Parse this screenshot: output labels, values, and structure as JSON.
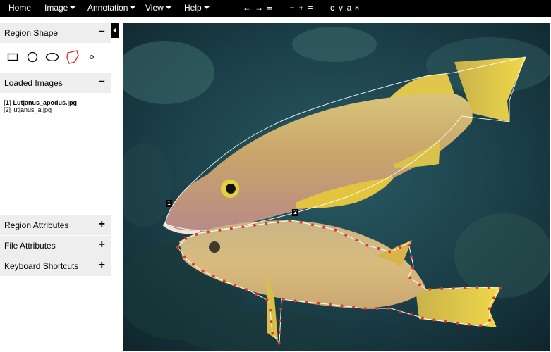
{
  "menu": {
    "home": "Home",
    "image": "Image",
    "annotation": "Annotation",
    "view": "View",
    "help": "Help"
  },
  "toolbar": {
    "prev": "←",
    "next": "→",
    "list": "≡",
    "zoom_out": "−",
    "zoom_in": "+",
    "zoom_reset": "=",
    "copy": "c",
    "paste": "v",
    "select_all": "a",
    "delete": "×"
  },
  "left_panel": {
    "region_shape": {
      "title": "Region Shape",
      "sign": "−",
      "active_shape": "polygon",
      "shape_icons": [
        "rectangle-icon",
        "circle-icon",
        "ellipse-icon",
        "polygon-icon",
        "point-icon"
      ],
      "active_color": "#e8332a"
    },
    "loaded_images": {
      "title": "Loaded Images",
      "sign": "−",
      "items": [
        {
          "label": "[1] Lutjanus_apodus.jpg",
          "active": true
        },
        {
          "label": "[2] lutjanus_a.jpg",
          "active": false
        }
      ]
    },
    "region_attributes": {
      "title": "Region Attributes",
      "sign": "+"
    },
    "file_attributes": {
      "title": "File Attributes",
      "sign": "+"
    },
    "keyboard_shortcuts": {
      "title": "Keyboard Shortcuts",
      "sign": "+"
    }
  },
  "regions": [
    {
      "id": "1",
      "stroke": "#ffffff",
      "vertex_color": "#ffffff"
    },
    {
      "id": "2",
      "stroke": "#ffffff",
      "vertex_color": "#e8332a"
    }
  ]
}
